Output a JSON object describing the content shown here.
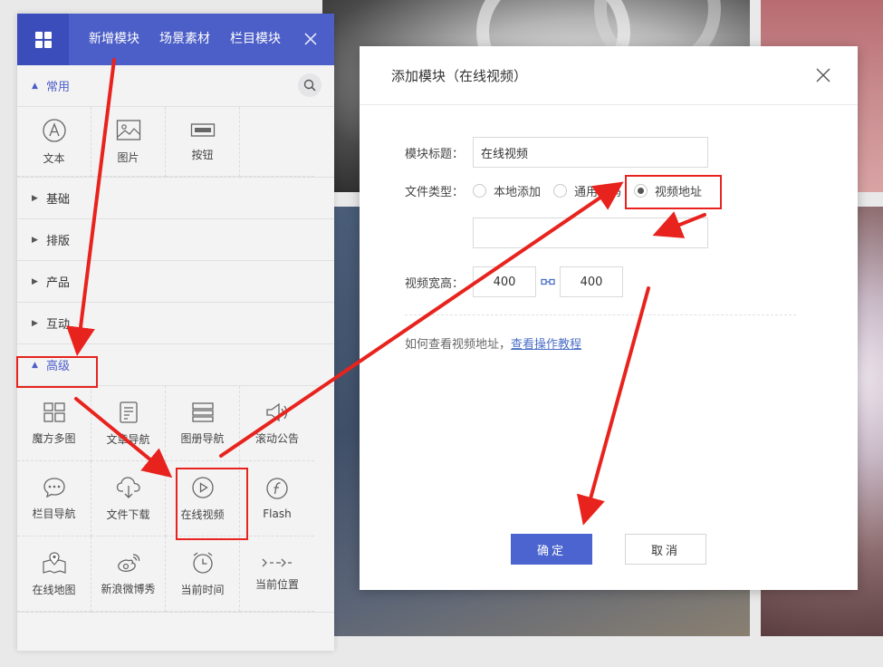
{
  "panel": {
    "tabs": [
      "新增模块",
      "场景素材",
      "栏目模块"
    ],
    "icons": {
      "grid": "grid-icon",
      "close": "close-icon",
      "search": "search-icon"
    },
    "sections": {
      "common": "常用",
      "basic": "基础",
      "layout": "排版",
      "product": "产品",
      "interact": "互动",
      "advanced": "高级"
    },
    "common_items": [
      {
        "label": "文本",
        "icon": "text-icon"
      },
      {
        "label": "图片",
        "icon": "image-icon"
      },
      {
        "label": "按钮",
        "icon": "button-icon"
      }
    ],
    "advanced_items": [
      {
        "label": "魔方多图",
        "icon": "multi-image-icon"
      },
      {
        "label": "文章导航",
        "icon": "article-nav-icon"
      },
      {
        "label": "图册导航",
        "icon": "album-nav-icon"
      },
      {
        "label": "滚动公告",
        "icon": "announcement-icon"
      },
      {
        "label": "栏目导航",
        "icon": "column-nav-icon"
      },
      {
        "label": "文件下载",
        "icon": "file-download-icon"
      },
      {
        "label": "在线视频",
        "icon": "online-video-icon"
      },
      {
        "label": "Flash",
        "icon": "flash-icon"
      },
      {
        "label": "在线地图",
        "icon": "map-icon"
      },
      {
        "label": "新浪微博秀",
        "icon": "weibo-icon"
      },
      {
        "label": "当前时间",
        "icon": "clock-icon"
      },
      {
        "label": "当前位置",
        "icon": "location-path-icon"
      }
    ]
  },
  "modal": {
    "title": "添加模块（在线视频）",
    "title_label": "模块标题：",
    "title_value": "在线视频",
    "file_type_label": "文件类型：",
    "file_types": [
      {
        "label": "本地添加",
        "selected": false
      },
      {
        "label": "通用代码",
        "selected": false
      },
      {
        "label": "视频地址",
        "selected": true
      }
    ],
    "url_value": "",
    "size_label": "视频宽高：",
    "width": "400",
    "height": "400",
    "help_text": "如何查看视频地址，",
    "help_link": "查看操作教程",
    "ok": "确定",
    "cancel": "取消"
  },
  "colors": {
    "brand": "#4c5ec7",
    "annotation": "#e8231d"
  }
}
